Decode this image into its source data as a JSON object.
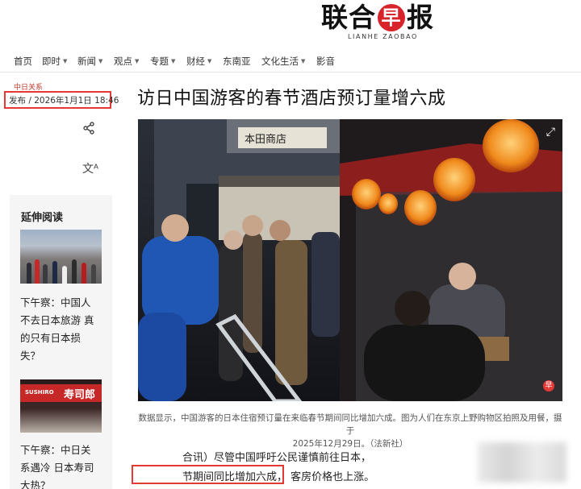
{
  "logo": {
    "chinese_before": "联合",
    "seal_char": "早",
    "chinese_after": "报",
    "english": "LIANHE ZAOBAO"
  },
  "nav": [
    {
      "label": "首页",
      "dropdown": false
    },
    {
      "label": "即时",
      "dropdown": true
    },
    {
      "label": "新闻",
      "dropdown": true
    },
    {
      "label": "观点",
      "dropdown": true
    },
    {
      "label": "专题",
      "dropdown": true
    },
    {
      "label": "财经",
      "dropdown": true
    },
    {
      "label": "东南亚",
      "dropdown": false
    },
    {
      "label": "文化生活",
      "dropdown": true
    },
    {
      "label": "影音",
      "dropdown": false
    }
  ],
  "article": {
    "kicker": "中日关系",
    "published": "发布 / 2026年1月1日 18:46",
    "title": "访日中国游客的春节酒店预订量增六成",
    "caption_line1": "数据显示，中国游客的日本住宿预订量在来临春节期间同比增加六成。图为人们在东京上野购物区拍照及用餐，摄于",
    "caption_line2": "2025年12月29日。（法新社）",
    "body_line1": "合讯）尽管中国呼吁公民谨慎前往日本，",
    "body_line2a": "节期间同比增加六成，",
    "body_line2b": "客房价格也上涨。"
  },
  "sidebar": {
    "title": "延伸阅读",
    "items": [
      {
        "lines": [
          "下午察：中国人",
          "不去日本旅游 真",
          "的只有日本损",
          "失？"
        ]
      },
      {
        "lines": [
          "下午察：中日关",
          "系遇冷 日本寿司",
          "大热？"
        ]
      }
    ],
    "sign_text_en": "SUSHIRO",
    "sign_text_cn": "寿司郎"
  },
  "photo": {
    "sign_text": "本田商店",
    "badge": "早"
  },
  "colors": {
    "accent_red": "#e53935",
    "seal_red": "#d8232a"
  },
  "icons": [
    "share-icon",
    "translate-icon",
    "expand-icon",
    "chevron-down-icon"
  ]
}
